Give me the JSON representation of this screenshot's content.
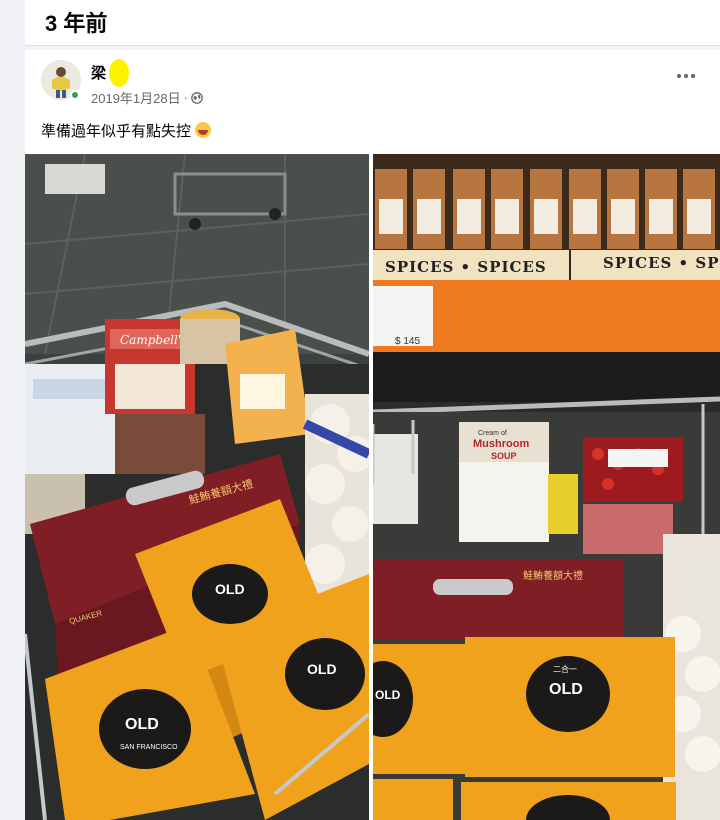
{
  "section": {
    "title": "3 年前"
  },
  "post": {
    "author": "梁  寶",
    "date": "2019年1月28日",
    "separator": "·",
    "text": "準備過年似乎有點失控",
    "emoji": "face-with-tongue-laughing-emoji",
    "privacy_icon": "globe-icon",
    "menu_icon": "more-options-icon"
  },
  "photos": {
    "right": {
      "shelf_left": "SPICES • SPICES",
      "shelf_right": "SPICES • SP",
      "price": "$ 145",
      "soup_brand": "Campbell's",
      "mushroom_label": "Cream of",
      "mushroom_title": "Mushroom",
      "mushroom_sub": "SOUP",
      "gift_box": "鮭鮪養額大禮"
    },
    "left": {
      "soup_brand": "Campbell's",
      "box_brand": "QUAKER",
      "gift_box": "鮭鮪養額大禮"
    },
    "coffee_brand": "OLD",
    "coffee_sub": "SAN FRANCISCO",
    "coffee_tag": "二合一"
  },
  "colors": {
    "accent_online": "#31a24c",
    "box_orange": "#f0a020",
    "shelf_orange": "#f07a20"
  }
}
